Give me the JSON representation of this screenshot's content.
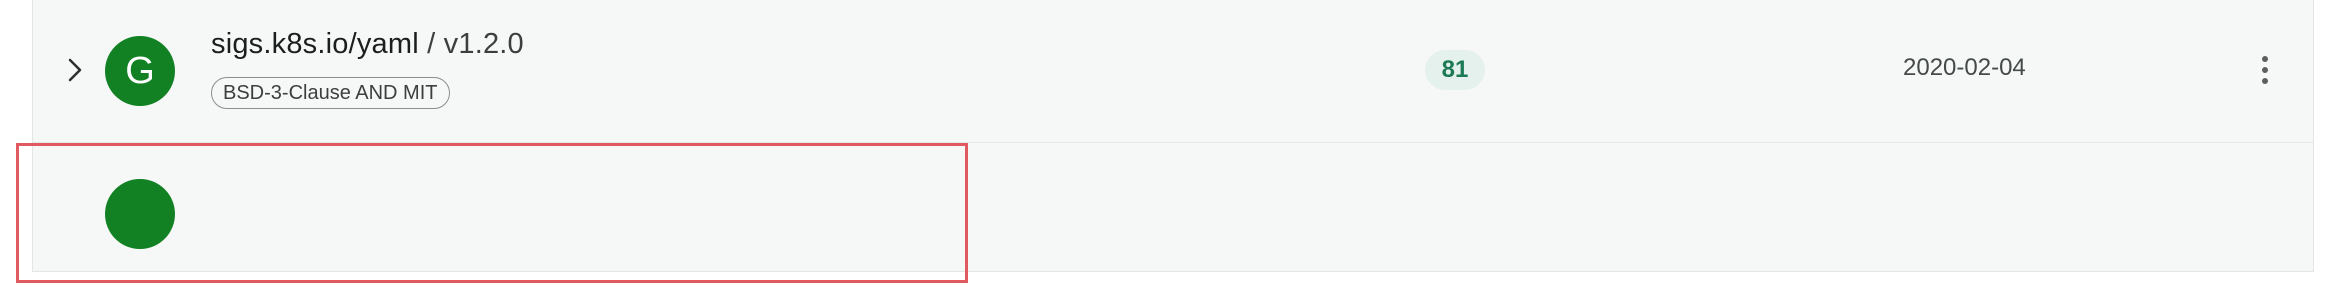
{
  "rows": [
    {
      "avatar_letter": "G",
      "avatar_color": "#118123",
      "package_name": "sigs.k8s.io/yaml",
      "separator": "/",
      "version": "v1.2.0",
      "license": "BSD-3-Clause AND MIT",
      "count": "81",
      "date": "2020-02-04",
      "icons": [
        "chevron-right-icon",
        "more-vertical-icon"
      ]
    },
    {
      "avatar_letter": "",
      "avatar_color": "#118123"
    }
  ],
  "colors": {
    "accent_green": "#118123",
    "count_badge_bg": "#e5f1ec",
    "count_badge_text": "#1c7a55",
    "highlight_border": "#e15a5f"
  }
}
